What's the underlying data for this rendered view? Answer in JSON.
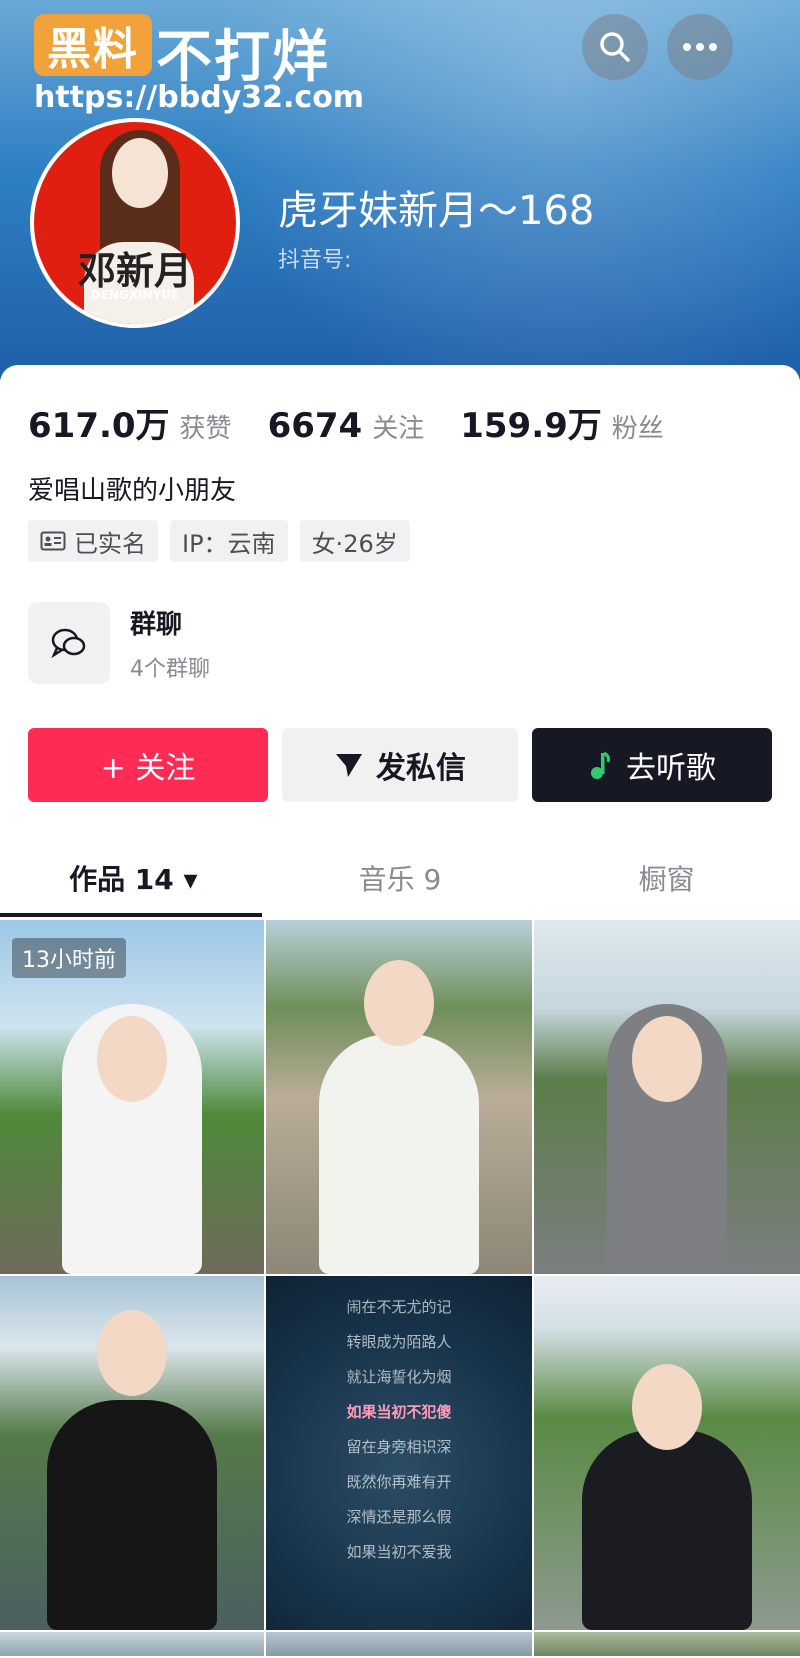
{
  "watermark": {
    "badge": "黑料",
    "text": "不打烊",
    "url": "https://bbdy32.com"
  },
  "header": {
    "search_icon": "search-icon",
    "more_icon": "more-icon"
  },
  "profile": {
    "avatar_name": "邓新月",
    "avatar_name_en": "DENGXINYUE",
    "username": "虎牙妹新月～168",
    "douyin_id_label": "抖音号:"
  },
  "stats": [
    {
      "value": "617.0万",
      "label": "获赞"
    },
    {
      "value": "6674",
      "label": "关注"
    },
    {
      "value": "159.9万",
      "label": "粉丝"
    }
  ],
  "bio": "爱唱山歌的小朋友",
  "tags": [
    {
      "icon": "id-card-icon",
      "label": "已实名"
    },
    {
      "label": "IP：云南"
    },
    {
      "label": "女·26岁"
    }
  ],
  "group_chat": {
    "title": "群聊",
    "subtitle": "4个群聊"
  },
  "buttons": {
    "follow": "+ 关注",
    "message": "发私信",
    "listen": "去听歌"
  },
  "tabs": [
    {
      "label": "作品 14 ▾",
      "active": true
    },
    {
      "label": "音乐 9",
      "active": false
    },
    {
      "label": "橱窗",
      "active": false
    }
  ],
  "grid": {
    "first_badge": "13小时前",
    "lyrics": [
      "闹在不无尤的记",
      "转眼成为陌路人",
      "就让海誓化为烟",
      "如果当初不犯傻",
      "留在身旁相识深",
      "既然你再难有开",
      "深情还是那么假",
      "如果当初不爱我"
    ]
  }
}
